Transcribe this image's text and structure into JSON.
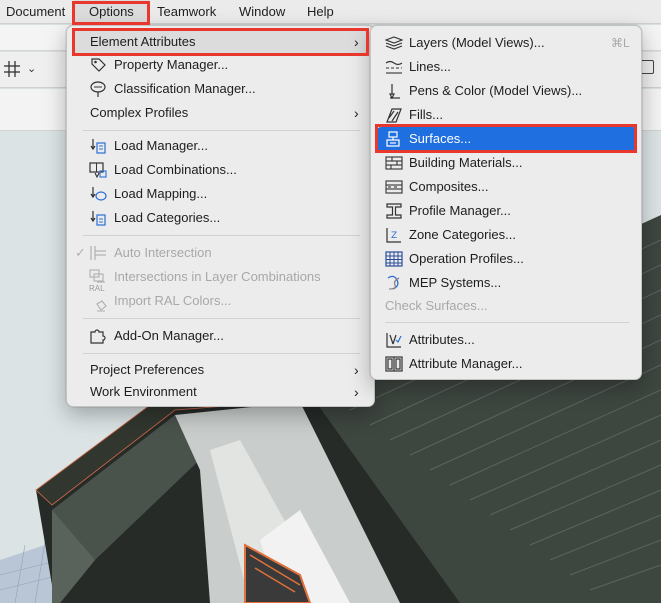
{
  "menubar": {
    "items": [
      {
        "label": "Document"
      },
      {
        "label": "Options",
        "active": true
      },
      {
        "label": "Teamwork"
      },
      {
        "label": "Window"
      },
      {
        "label": "Help"
      }
    ]
  },
  "options_menu": {
    "element_attributes": "Element Attributes",
    "property_manager": "Property Manager...",
    "classification_manager": "Classification Manager...",
    "complex_profiles": "Complex Profiles",
    "load_manager": "Load Manager...",
    "load_combinations": "Load Combinations...",
    "load_mapping": "Load Mapping...",
    "load_categories": "Load Categories...",
    "auto_intersection": "Auto Intersection",
    "intersections_layer": "Intersections in Layer Combinations",
    "import_ral": "Import RAL Colors...",
    "ral_badge": "RAL",
    "add_on_manager": "Add-On Manager...",
    "project_preferences": "Project Preferences",
    "work_environment": "Work Environment"
  },
  "attributes_menu": {
    "layers": "Layers (Model Views)...",
    "layers_shortcut": "⌘L",
    "lines": "Lines...",
    "pens": "Pens & Color (Model Views)...",
    "fills": "Fills...",
    "surfaces": "Surfaces...",
    "building_materials": "Building Materials...",
    "composites": "Composites...",
    "profile_manager": "Profile Manager...",
    "zone_categories": "Zone Categories...",
    "operation_profiles": "Operation Profiles...",
    "mep_systems": "MEP Systems...",
    "check_surfaces": "Check Surfaces...",
    "attributes": "Attributes...",
    "attribute_manager": "Attribute Manager..."
  },
  "colors": {
    "highlight": "#1f6fe0",
    "annotation_red": "#e8372c"
  }
}
